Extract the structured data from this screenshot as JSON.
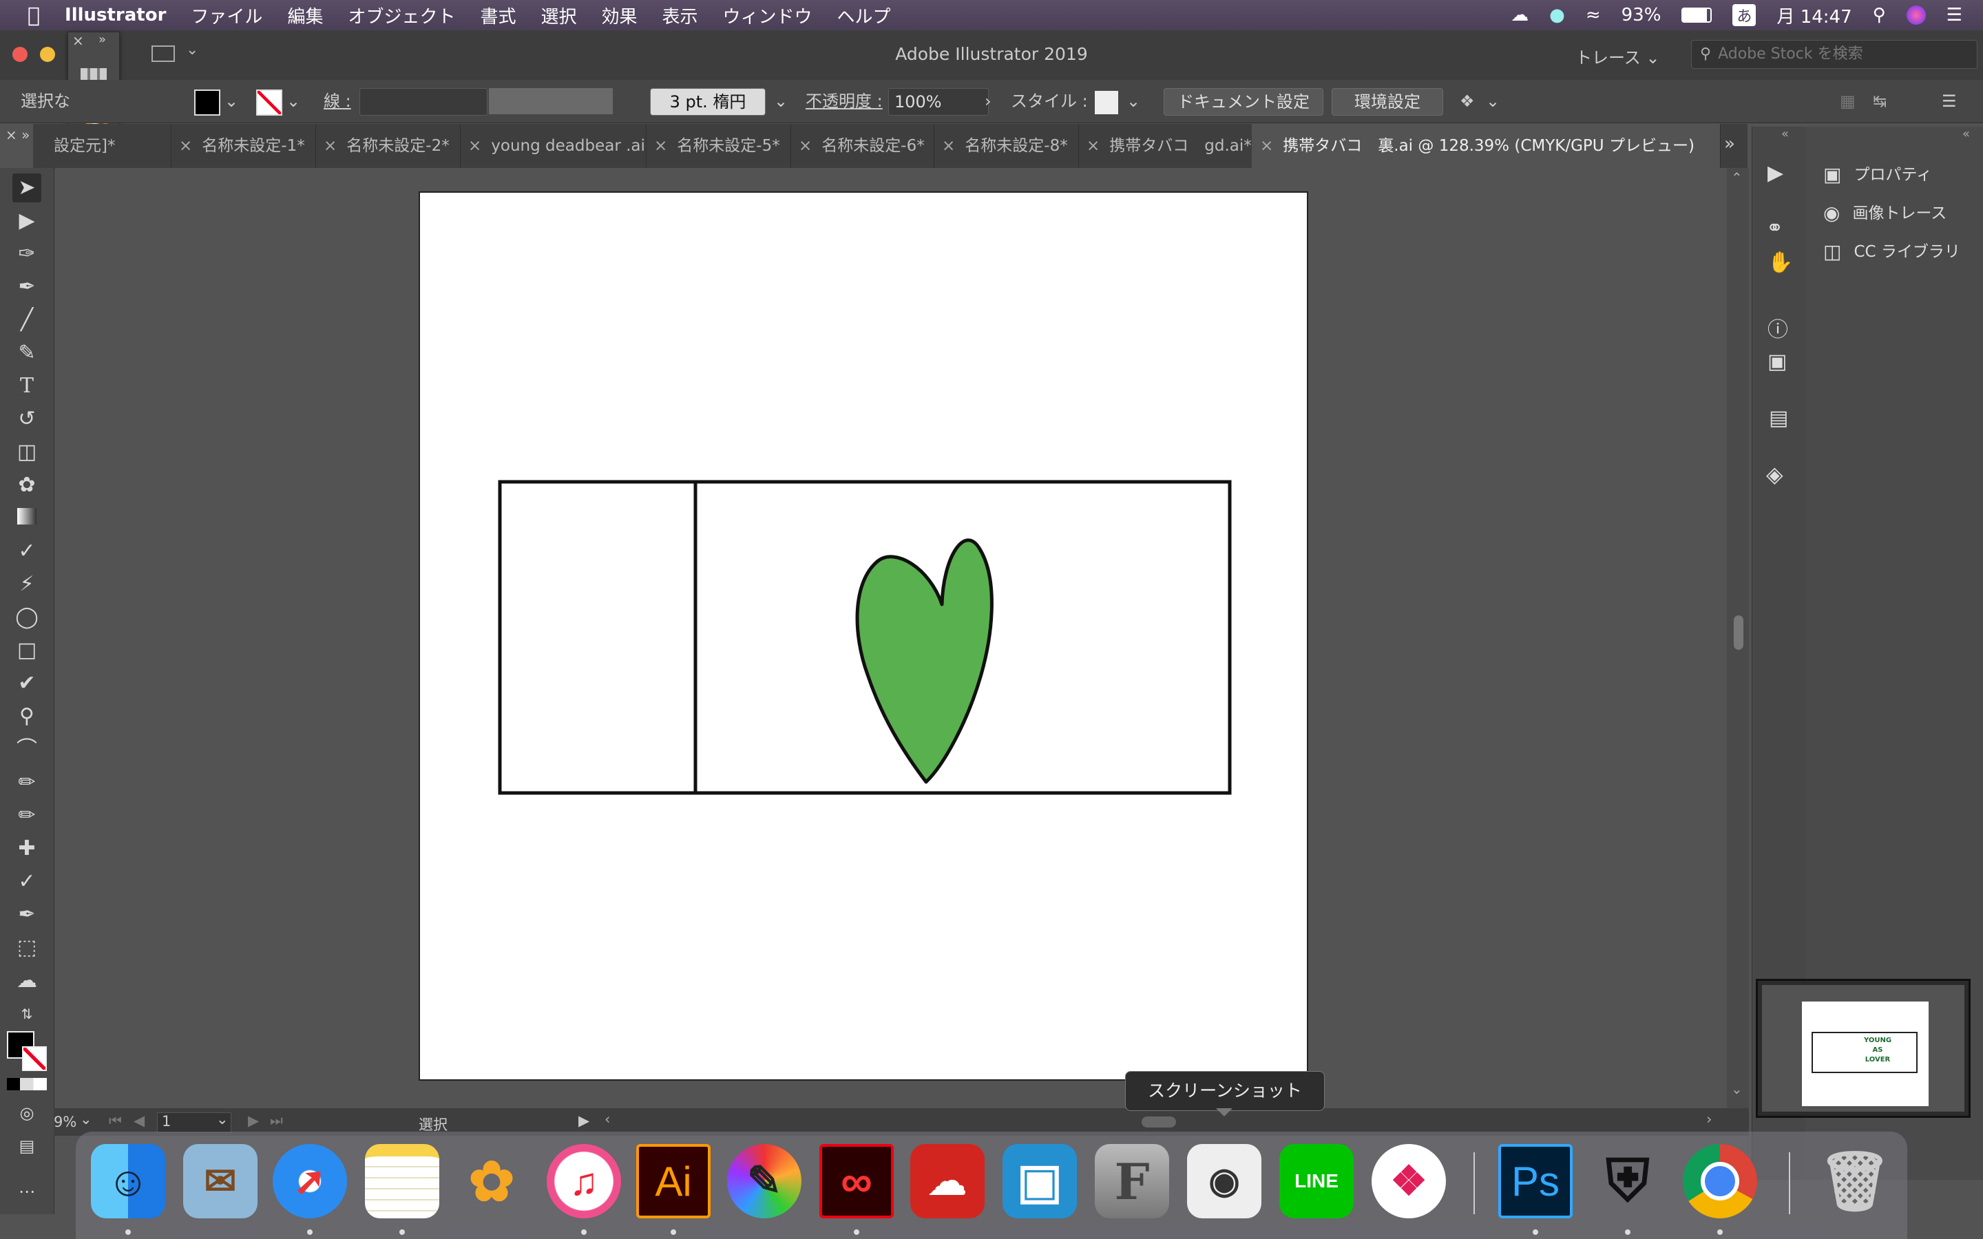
{
  "menubar": {
    "app": "Illustrator",
    "items": [
      "ファイル",
      "編集",
      "オブジェクト",
      "書式",
      "選択",
      "効果",
      "表示",
      "ウィンドウ",
      "ヘルプ"
    ],
    "battery": "93%",
    "input_method": "あ",
    "clock": "月 14:47"
  },
  "window": {
    "title": "Adobe Illustrator 2019",
    "trace_label": "トレース",
    "search_placeholder": "Adobe Stock を検索"
  },
  "controlbar": {
    "selection_label": "選択な",
    "stroke_label": "線 :",
    "brush_value": "3 pt. 楕円",
    "opacity_label": "不透明度 :",
    "opacity_value": "100%",
    "style_label": "スタイル :",
    "document_settings": "ドキュメント設定",
    "preferences": "環境設定"
  },
  "tabs": [
    "設定元]*",
    "名称未設定-1*",
    "名称未設定-2*",
    "young deadbear .ai",
    "名称未設定-5*",
    "名称未設定-6*",
    "名称未設定-8*",
    "携帯タバコ　gd.ai*",
    "携帯タバコ　裏.ai @ 128.39% (CMYK/GPU プレビュー)"
  ],
  "panel": {
    "items": [
      "プロパティ",
      "画像トレース",
      "CC ライブラリ"
    ]
  },
  "statusbar": {
    "zoom": "9%",
    "artboard_number": "1",
    "tool_name": "選択"
  },
  "tooltip": "スクリーンショット",
  "artwork": {
    "heart_color": "#59b04e",
    "stroke_color": "#111111"
  },
  "navigator_text": "YOUNG AS LOVER",
  "dock_labels": {
    "illustrator": "Ai",
    "photoshop": "Ps",
    "line": "LINE"
  }
}
